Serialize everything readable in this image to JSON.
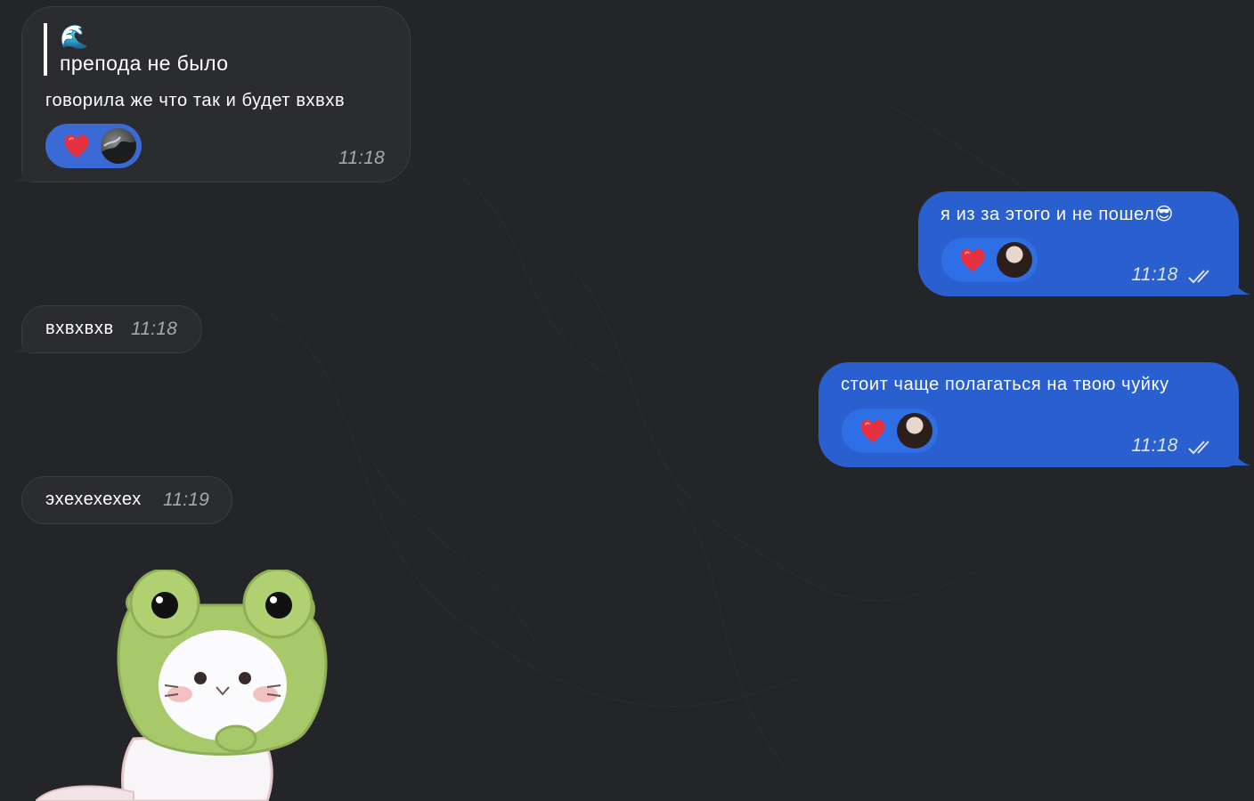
{
  "messages": [
    {
      "id": "m1",
      "direction": "incoming",
      "reply": {
        "emoji": "🌊",
        "text": "препода не было"
      },
      "text": "говорила же что так и будет вхвхв",
      "reaction": {
        "emoji": "heart-icon",
        "by": "contact"
      },
      "time": "11:18"
    },
    {
      "id": "m2",
      "direction": "outgoing",
      "text": "я из за этого и не пошел😎",
      "reaction": {
        "emoji": "heart-icon",
        "by": "contact"
      },
      "time": "11:18",
      "status": "read"
    },
    {
      "id": "m3",
      "direction": "incoming",
      "text": "вхвхвхв",
      "time": "11:18"
    },
    {
      "id": "m4",
      "direction": "outgoing",
      "text": "стоит чаще полагаться на твою чуйку",
      "reaction": {
        "emoji": "heart-icon",
        "by": "contact"
      },
      "time": "11:18",
      "status": "read"
    },
    {
      "id": "m5",
      "direction": "incoming",
      "text": "эхехехехех",
      "time": "11:19"
    },
    {
      "id": "m6",
      "direction": "incoming",
      "sticker": "frog-hat-cat-sticker"
    }
  ],
  "colors": {
    "background": "#232528",
    "incoming_bubble": "#2a2c2f",
    "outgoing_bubble": "#2a5fd0",
    "reaction_heart": "#e5303e"
  }
}
